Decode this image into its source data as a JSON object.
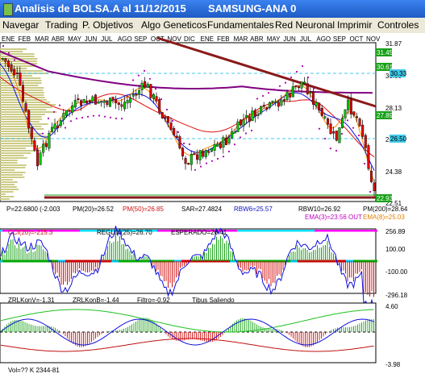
{
  "window": {
    "title": "Analisis de BOLSA.A al 11/12/2015",
    "instrument": "SAMSUNG-ANA 0"
  },
  "menu": [
    "Navegar",
    "Trading",
    "P. Objetivos",
    "Algo Geneticos",
    "Fundamentales",
    "Red Neuronal",
    "Imprimir",
    "Controles"
  ],
  "months": [
    "ENE",
    "FEB",
    "MAR",
    "ABR",
    "MAY",
    "JUN",
    "JUL",
    "AGO",
    "SEP",
    "OCT",
    "NOV",
    "DIC",
    "ENE",
    "FEB",
    "MAR",
    "ABR",
    "MAY",
    "JUN",
    "JUL",
    "AGO",
    "SEP",
    "OCT",
    "NOV"
  ],
  "price_panel": {
    "y_ticks": [
      "31.87",
      "30.00",
      "28.13",
      "26.25",
      "24.38",
      "22.51"
    ],
    "levels": [
      {
        "label": "31.45",
        "color": "#18a018"
      },
      {
        "label": "30.61",
        "color": "#18a018"
      },
      {
        "label": "30.33",
        "color": "#40c8e8"
      },
      {
        "label": "27.89",
        "color": "#18a018"
      },
      {
        "label": "26.50",
        "color": "#40c8e8"
      },
      {
        "label": "22.93",
        "color": "#18a018"
      }
    ],
    "info": {
      "p": "P=22.6800 (-2.003",
      "pm20": "PM(20)=26.52",
      "pm50": "PM(50)=26.85",
      "sar": "SAR=27.4824",
      "rbw6": "RBW6=25.57",
      "rbw10": "RBW10=26.92",
      "pm200": "PM(200)=28.64",
      "ema3": "EMA(3)=23.56 OUT",
      "ema8": "EMA(8)=25.03"
    }
  },
  "cci_panel": {
    "labels": {
      "cci": "CCI(20)=-215.3",
      "regline": "REGLIN(25)=26.70",
      "esperado": "ESPERADO=26.41"
    },
    "y_ticks": [
      "256.89",
      "100.00",
      "-100.00",
      "-296.18"
    ]
  },
  "zrl_panel": {
    "labels": {
      "kon_v": "ZRLKonV=-1.31",
      "kon_b": "ZRLKonB=-1.44",
      "filtro": "Filtro=-0.92",
      "tibus": "Tibus Saliendo"
    },
    "y_ticks": [
      "4.60",
      "-3.98"
    ],
    "bottom_text": "Vol=?? K  2344-81"
  },
  "colors": {
    "title_bar": "#1e5bc4",
    "menu_bg": "#ece9d8",
    "candle_up": "#00c800",
    "candle_down": "#dd0000",
    "pm200": "#800080",
    "trend": "#8b1a1a"
  }
}
